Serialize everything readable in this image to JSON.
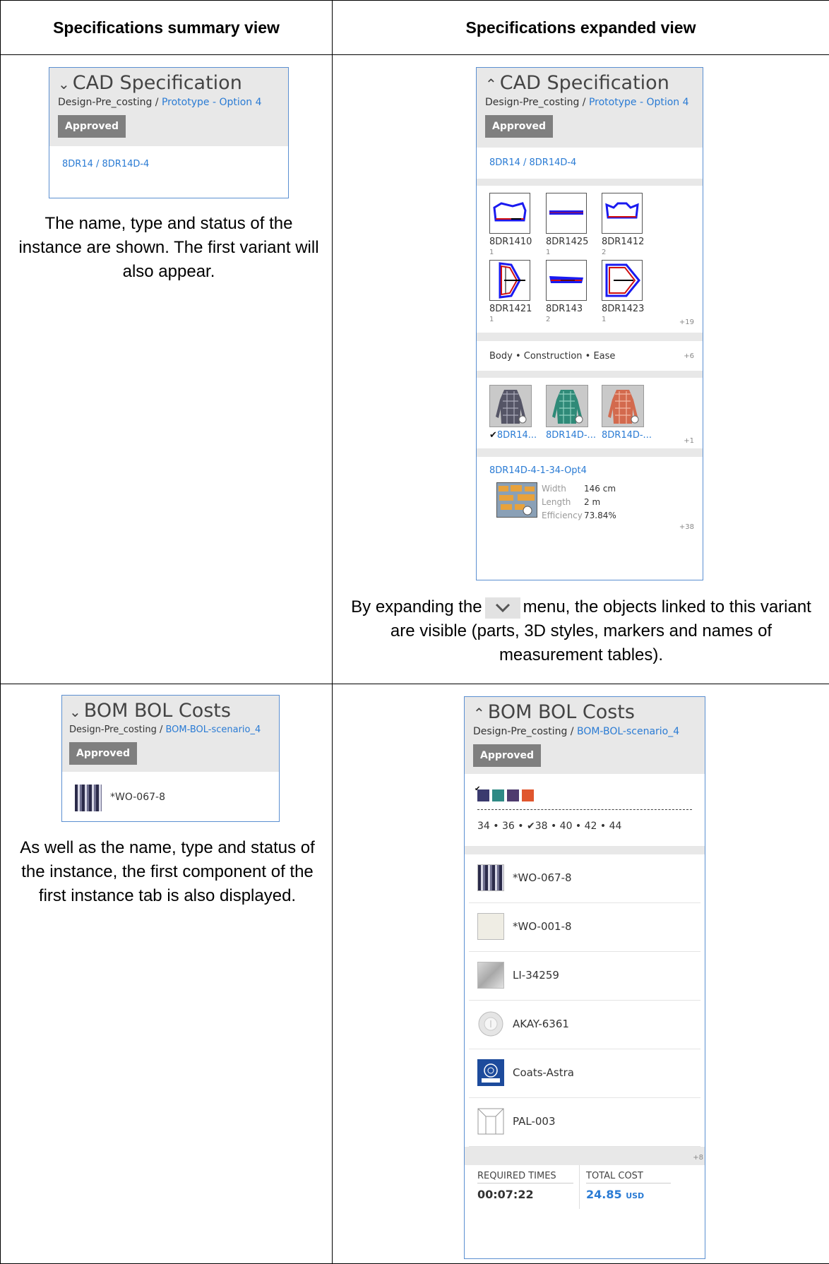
{
  "headers": {
    "left": "Specifications summary view",
    "right": "Specifications expanded view"
  },
  "cad_summary": {
    "chevron": "⌄",
    "title": "CAD Specification",
    "path_prefix": "Design-Pre_costing / ",
    "path_link": "Prototype - Option 4",
    "status": "Approved",
    "variant": "8DR14 / 8DR14D-4",
    "description": "The name, type and status of the instance are shown. The first variant will also appear."
  },
  "cad_expanded": {
    "chevron": "⌃",
    "title": "CAD Specification",
    "path_prefix": "Design-Pre_costing / ",
    "path_link": "Prototype - Option 4",
    "status": "Approved",
    "variant": "8DR14 / 8DR14D-4",
    "parts": [
      {
        "name": "8DR1410",
        "qty": "1"
      },
      {
        "name": "8DR1425",
        "qty": "1"
      },
      {
        "name": "8DR1412",
        "qty": "2"
      },
      {
        "name": "8DR1421",
        "qty": "1"
      },
      {
        "name": "8DR143",
        "qty": "2"
      },
      {
        "name": "8DR1423",
        "qty": "1"
      }
    ],
    "parts_more": "+19",
    "measurement_tables": "Body • Construction • Ease",
    "measurement_more": "+6",
    "styles": [
      {
        "name": "8DR14...",
        "color": "#5a5a68"
      },
      {
        "name": "8DR14D-...",
        "color": "#2f8a78"
      },
      {
        "name": "8DR14D-...",
        "color": "#d36a4e"
      }
    ],
    "styles_more": "+1",
    "marker": {
      "name": "8DR14D-4-1-34-Opt4",
      "width_label": "Width",
      "width_value": "146 cm",
      "length_label": "Length",
      "length_value": "2 m",
      "efficiency_label": "Efficiency",
      "efficiency_value": "73.84%"
    },
    "marker_more": "+38",
    "description_before": "By expanding the",
    "description_after": "menu, the objects linked to this variant are visible (parts, 3D styles, markers and names of measurement tables)."
  },
  "bom_summary": {
    "chevron": "⌄",
    "title": "BOM BOL Costs",
    "path_prefix": "Design-Pre_costing / ",
    "path_link": "BOM-BOL-scenario_4",
    "status": "Approved",
    "component": "*WO-067-8",
    "description": "As well as the name, type and status of the instance, the first component of the first instance tab is also displayed."
  },
  "bom_expanded": {
    "chevron": "⌃",
    "title": "BOM BOL Costs",
    "path_prefix": "Design-Pre_costing / ",
    "path_link": "BOM-BOL-scenario_4",
    "status": "Approved",
    "colors": [
      "#3a3a6e",
      "#2f8a85",
      "#4e3b6e",
      "#e0562e"
    ],
    "sizes_a": "34 • 36 •",
    "sizes_b": "38 • 40 • 42 • 44",
    "components": [
      "*WO-067-8",
      "*WO-001-8",
      "LI-34259",
      "AKAY-6361",
      "Coats-Astra",
      "PAL-003"
    ],
    "components_more": "+8",
    "required_times_label": "REQUIRED TIMES",
    "required_times_value": "00:07:22",
    "total_cost_label": "TOTAL COST",
    "total_cost_value": "24.85",
    "total_cost_currency": "USD"
  }
}
